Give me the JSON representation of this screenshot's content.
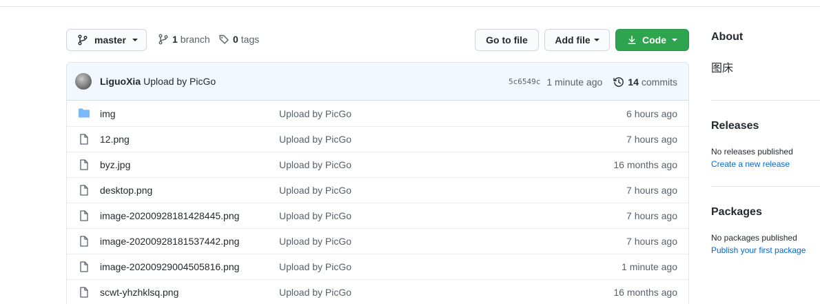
{
  "branch": {
    "name": "master",
    "branch_count": "1",
    "branch_word": "branch",
    "tag_count": "0",
    "tag_word": "tags"
  },
  "actions": {
    "goto_file": "Go to file",
    "add_file": "Add file",
    "code": "Code"
  },
  "latest_commit": {
    "author": "LiguoXia",
    "message": "Upload by PicGo",
    "sha": "5c6549c",
    "time": "1 minute ago",
    "commit_count": "14",
    "commit_word": "commits"
  },
  "files": [
    {
      "type": "folder",
      "name": "img",
      "message": "Upload by PicGo",
      "age": "6 hours ago"
    },
    {
      "type": "file",
      "name": "12.png",
      "message": "Upload by PicGo",
      "age": "7 hours ago"
    },
    {
      "type": "file",
      "name": "byz.jpg",
      "message": "Upload by PicGo",
      "age": "16 months ago"
    },
    {
      "type": "file",
      "name": "desktop.png",
      "message": "Upload by PicGo",
      "age": "7 hours ago"
    },
    {
      "type": "file",
      "name": "image-20200928181428445.png",
      "message": "Upload by PicGo",
      "age": "7 hours ago"
    },
    {
      "type": "file",
      "name": "image-20200928181537442.png",
      "message": "Upload by PicGo",
      "age": "7 hours ago"
    },
    {
      "type": "file",
      "name": "image-20200929004505816.png",
      "message": "Upload by PicGo",
      "age": "1 minute ago"
    },
    {
      "type": "file",
      "name": "scwt-yhzhklsq.png",
      "message": "Upload by PicGo",
      "age": "16 months ago"
    }
  ],
  "about": {
    "title": "About",
    "description": "图床"
  },
  "releases": {
    "title": "Releases",
    "empty_text": "No releases published",
    "link": "Create a new release"
  },
  "packages": {
    "title": "Packages",
    "empty_text": "No packages published",
    "link": "Publish your first package"
  },
  "colors": {
    "accent": "#2ea44f",
    "link": "#0366d6",
    "folder": "#79b8ff",
    "commit_bg": "#f1f8ff"
  }
}
